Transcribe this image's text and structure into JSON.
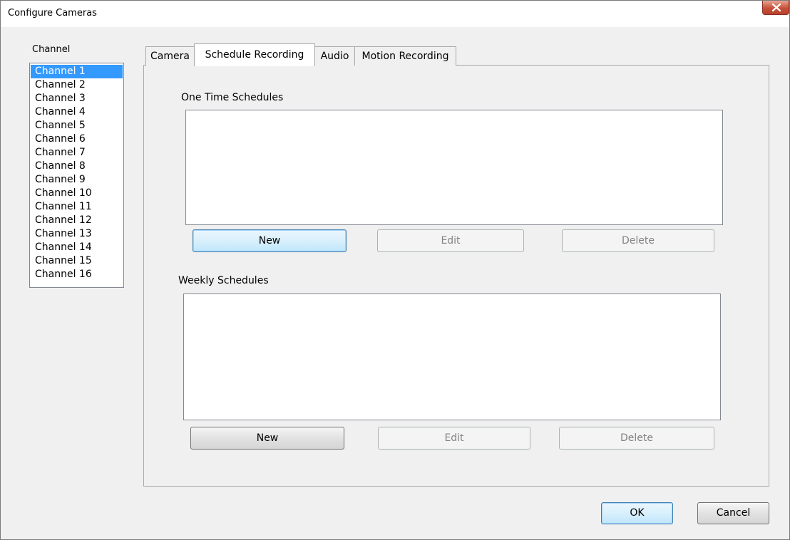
{
  "window": {
    "title": "Configure Cameras"
  },
  "channels": {
    "label": "Channel",
    "selected_index": 0,
    "items": [
      "Channel 1",
      "Channel 2",
      "Channel 3",
      "Channel 4",
      "Channel 5",
      "Channel 6",
      "Channel 7",
      "Channel 8",
      "Channel 9",
      "Channel 10",
      "Channel 11",
      "Channel 12",
      "Channel 13",
      "Channel 14",
      "Channel 15",
      "Channel 16"
    ]
  },
  "tabs": [
    {
      "label": "Camera",
      "active": false
    },
    {
      "label": "Schedule Recording",
      "active": true
    },
    {
      "label": "Audio",
      "active": false
    },
    {
      "label": "Motion Recording",
      "active": false
    }
  ],
  "one_time": {
    "label": "One Time Schedules",
    "new_label": "New",
    "edit_label": "Edit",
    "delete_label": "Delete"
  },
  "weekly": {
    "label": "Weekly Schedules",
    "new_label": "New",
    "edit_label": "Edit",
    "delete_label": "Delete"
  },
  "footer": {
    "ok_label": "OK",
    "cancel_label": "Cancel"
  },
  "colors": {
    "selection": "#3399ff",
    "close_button": "#c7503a",
    "focus_border": "#3c7fb1"
  }
}
